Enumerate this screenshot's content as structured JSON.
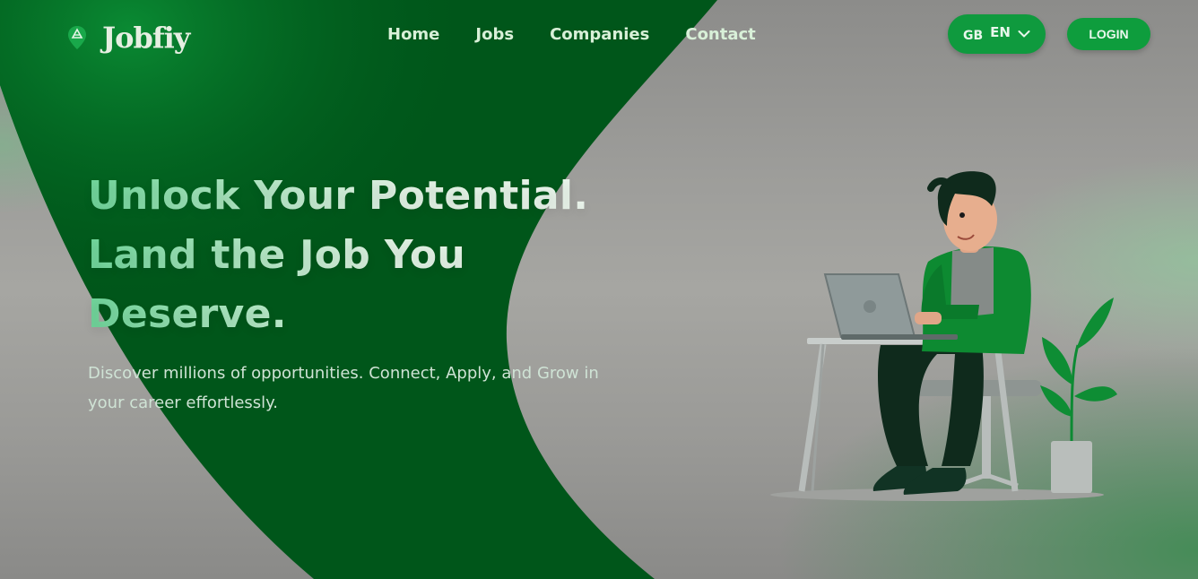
{
  "brand": {
    "name": "Jobfiy",
    "logo_icon": "map-pin-icon"
  },
  "nav": {
    "links": [
      {
        "label": "Home"
      },
      {
        "label": "Jobs"
      },
      {
        "label": "Companies"
      },
      {
        "label": "Contact"
      }
    ]
  },
  "language": {
    "flag": "GB",
    "code": "EN",
    "icon": "chevron-down-icon"
  },
  "login": {
    "label": "LOGIN"
  },
  "hero": {
    "title_lines": [
      "Unlock Your Potential.",
      "Land the Job You",
      "Deserve."
    ],
    "subtitle": "Discover millions of opportunities. Connect, Apply, and Grow in your career effortlessly."
  },
  "colors": {
    "brand_green": "#0e9d3d",
    "dark_green": "#00561a",
    "accent_light_green": "#6fd59a"
  }
}
